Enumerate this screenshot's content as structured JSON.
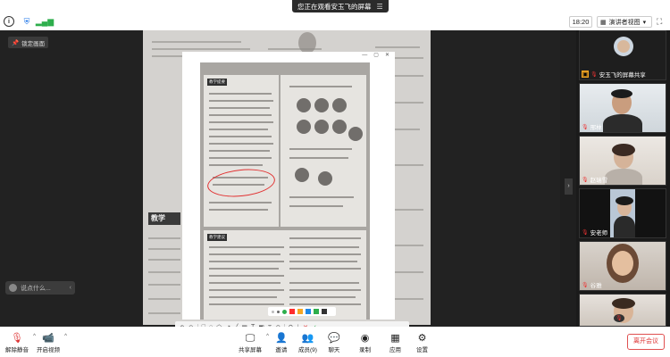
{
  "banner": {
    "text": "您正在观看安玉飞的屏幕"
  },
  "top": {
    "time": "18:20",
    "view_mode": "演讲者视图"
  },
  "lock_screen": {
    "label": "锁定画面"
  },
  "chat": {
    "placeholder": "说点什么..."
  },
  "book": {
    "section_title": "教学"
  },
  "photo": {
    "section_label_1": "教学提要",
    "section_label_2": "教学建议"
  },
  "palette": {
    "colors": [
      "#ff2d2d",
      "#f5a623",
      "#1e88e5",
      "#2eae4c",
      "#333333"
    ]
  },
  "participants": [
    {
      "name": "安玉飞的屏幕共享"
    },
    {
      "name": "邢林"
    },
    {
      "name": "赵瑞雪"
    },
    {
      "name": "安老师"
    },
    {
      "name": "谷雅"
    }
  ],
  "bottom": {
    "mute": "解除静音",
    "video": "开启视频",
    "share": "共享屏幕",
    "invite": "邀请",
    "members": "成员(9)",
    "chat": "聊天",
    "record": "录制",
    "apps": "应用",
    "settings": "设置",
    "leave": "离开会议"
  }
}
